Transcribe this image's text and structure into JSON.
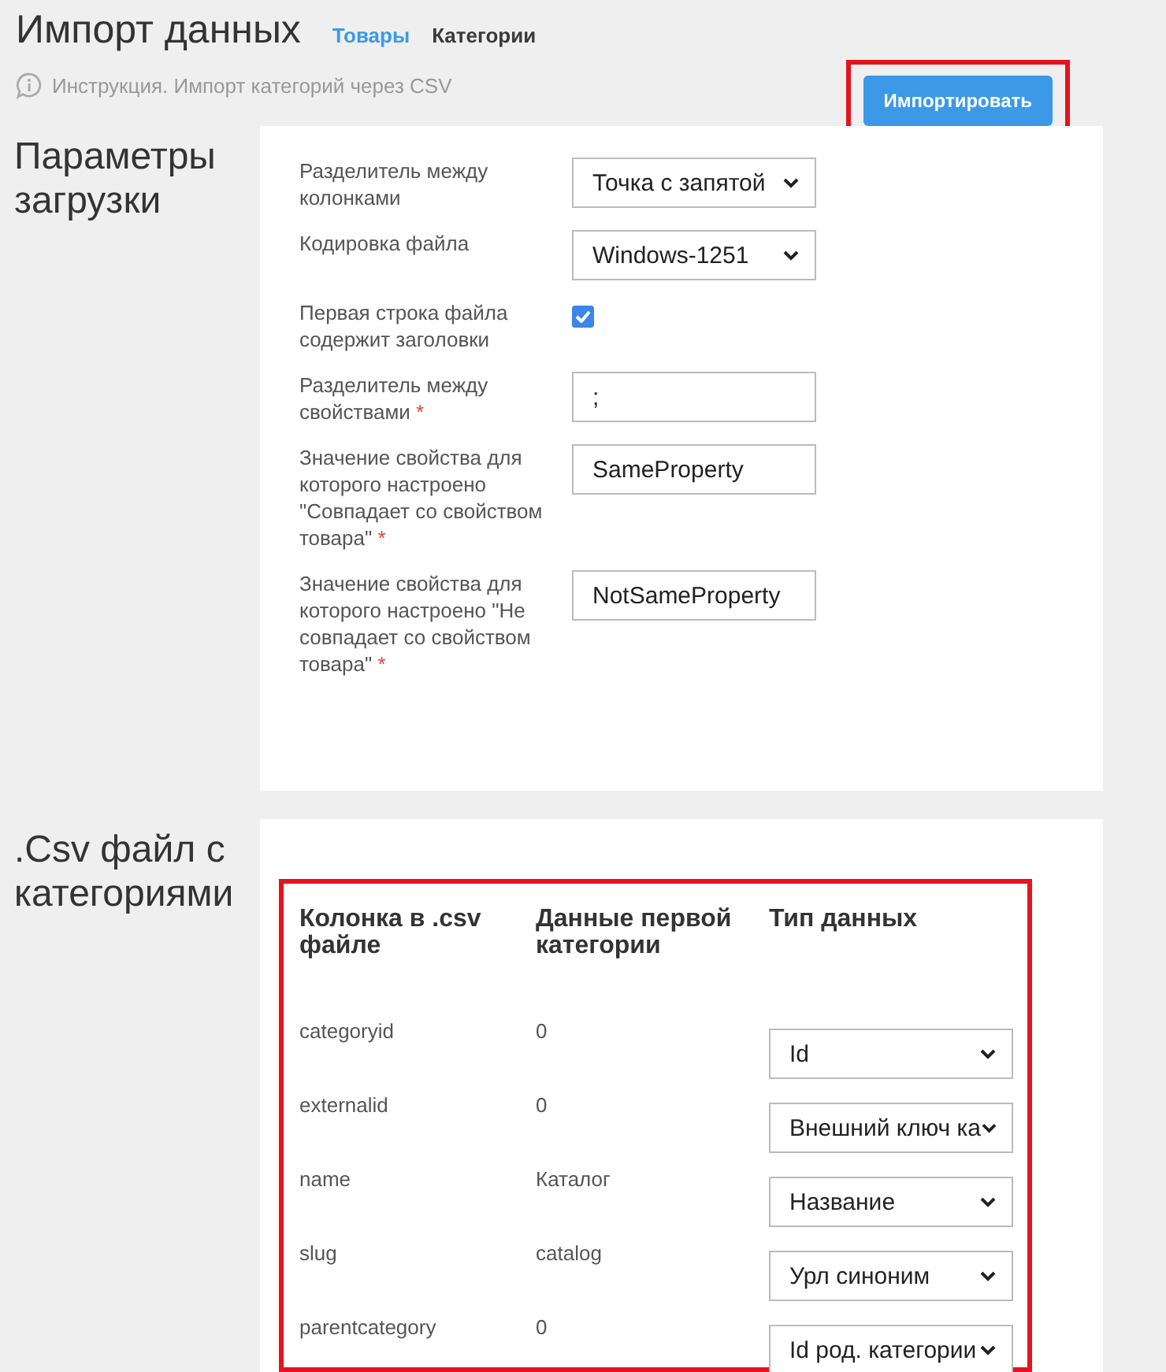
{
  "header": {
    "title": "Импорт данных",
    "tabs": [
      {
        "label": "Товары",
        "selected": false
      },
      {
        "label": "Категории",
        "selected": true
      }
    ],
    "instruction": "Инструкция. Импорт категорий через CSV"
  },
  "import_button": {
    "label": "Импортировать",
    "highlighted": true
  },
  "settings": {
    "title": "Параметры загрузки",
    "fields": [
      {
        "kind": "select",
        "label": "Разделитель между колонками",
        "value": "Точка с запятой"
      },
      {
        "kind": "select",
        "label": "Кодировка файла",
        "value": "Windows-1251"
      },
      {
        "kind": "checkbox",
        "label": "Первая строка файла содержит заголовки",
        "checked": true
      },
      {
        "kind": "text",
        "label": "Разделитель между свойствами",
        "value": ";",
        "required_mark": "*"
      },
      {
        "kind": "text",
        "label": "Значение свойства для которого настроено \"Совпадает со свойством товара\"",
        "value": "SameProperty",
        "required_mark": "*"
      },
      {
        "kind": "text",
        "label": "Значение свойства для которого настроено \"Не совпадает со свойством товара\"",
        "value": "NotSameProperty",
        "required_mark": "*"
      }
    ]
  },
  "csv": {
    "title": ".Csv файл с категориями",
    "highlighted": true,
    "columns": [
      "Колонка в .csv файле",
      "Данные первой категории",
      "Тип данных"
    ],
    "rows": [
      {
        "column": "categoryid",
        "data": "0",
        "type": "Id"
      },
      {
        "column": "externalid",
        "data": "0",
        "type": "Внешний ключ ка"
      },
      {
        "column": "name",
        "data": "Каталог",
        "type": "Название"
      },
      {
        "column": "slug",
        "data": "catalog",
        "type": "Урл синоним"
      },
      {
        "column": "parentcategory",
        "data": "0",
        "type": "Id род. категории"
      }
    ]
  }
}
